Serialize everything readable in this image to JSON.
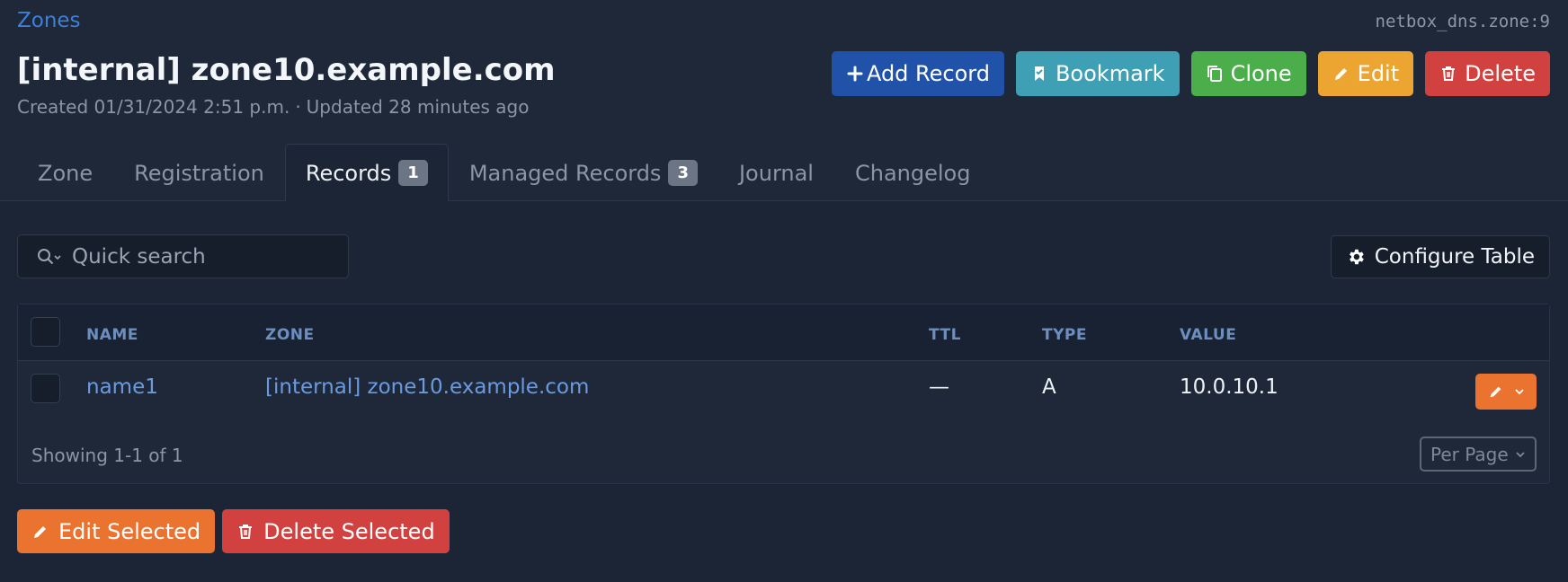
{
  "breadcrumb": {
    "label": "Zones"
  },
  "object_id": "netbox_dns.zone:9",
  "title": "[internal] zone10.example.com",
  "meta": {
    "created": "Created 01/31/2024 2:51 p.m.",
    "separator": "·",
    "updated": "Updated 28 minutes ago"
  },
  "actions": {
    "add_record": "Add Record",
    "bookmark": "Bookmark",
    "clone": "Clone",
    "edit": "Edit",
    "delete": "Delete"
  },
  "tabs": [
    {
      "label": "Zone"
    },
    {
      "label": "Registration"
    },
    {
      "label": "Records",
      "badge": "1",
      "active": true
    },
    {
      "label": "Managed Records",
      "badge": "3"
    },
    {
      "label": "Journal"
    },
    {
      "label": "Changelog"
    }
  ],
  "search": {
    "placeholder": "Quick search",
    "value": ""
  },
  "configure_table": "Configure Table",
  "table": {
    "columns": [
      "NAME",
      "ZONE",
      "TTL",
      "TYPE",
      "VALUE"
    ],
    "rows": [
      {
        "name": "name1",
        "zone": "[internal] zone10.example.com",
        "ttl": "—",
        "type": "A",
        "value": "10.0.10.1"
      }
    ],
    "showing": "Showing 1-1 of 1",
    "per_page": "Per Page"
  },
  "bulk": {
    "edit": "Edit Selected",
    "delete": "Delete Selected"
  },
  "colors": {
    "primary": "#1f52a8",
    "bookmark": "#3fa0b5",
    "clone": "#4cad4b",
    "edit": "#eca530",
    "delete": "#d1413f",
    "orange": "#ea7330"
  },
  "icons": [
    "plus-icon",
    "bookmark-icon",
    "copy-icon",
    "pencil-icon",
    "trash-icon",
    "search-icon",
    "gear-icon",
    "chevron-down-icon"
  ]
}
